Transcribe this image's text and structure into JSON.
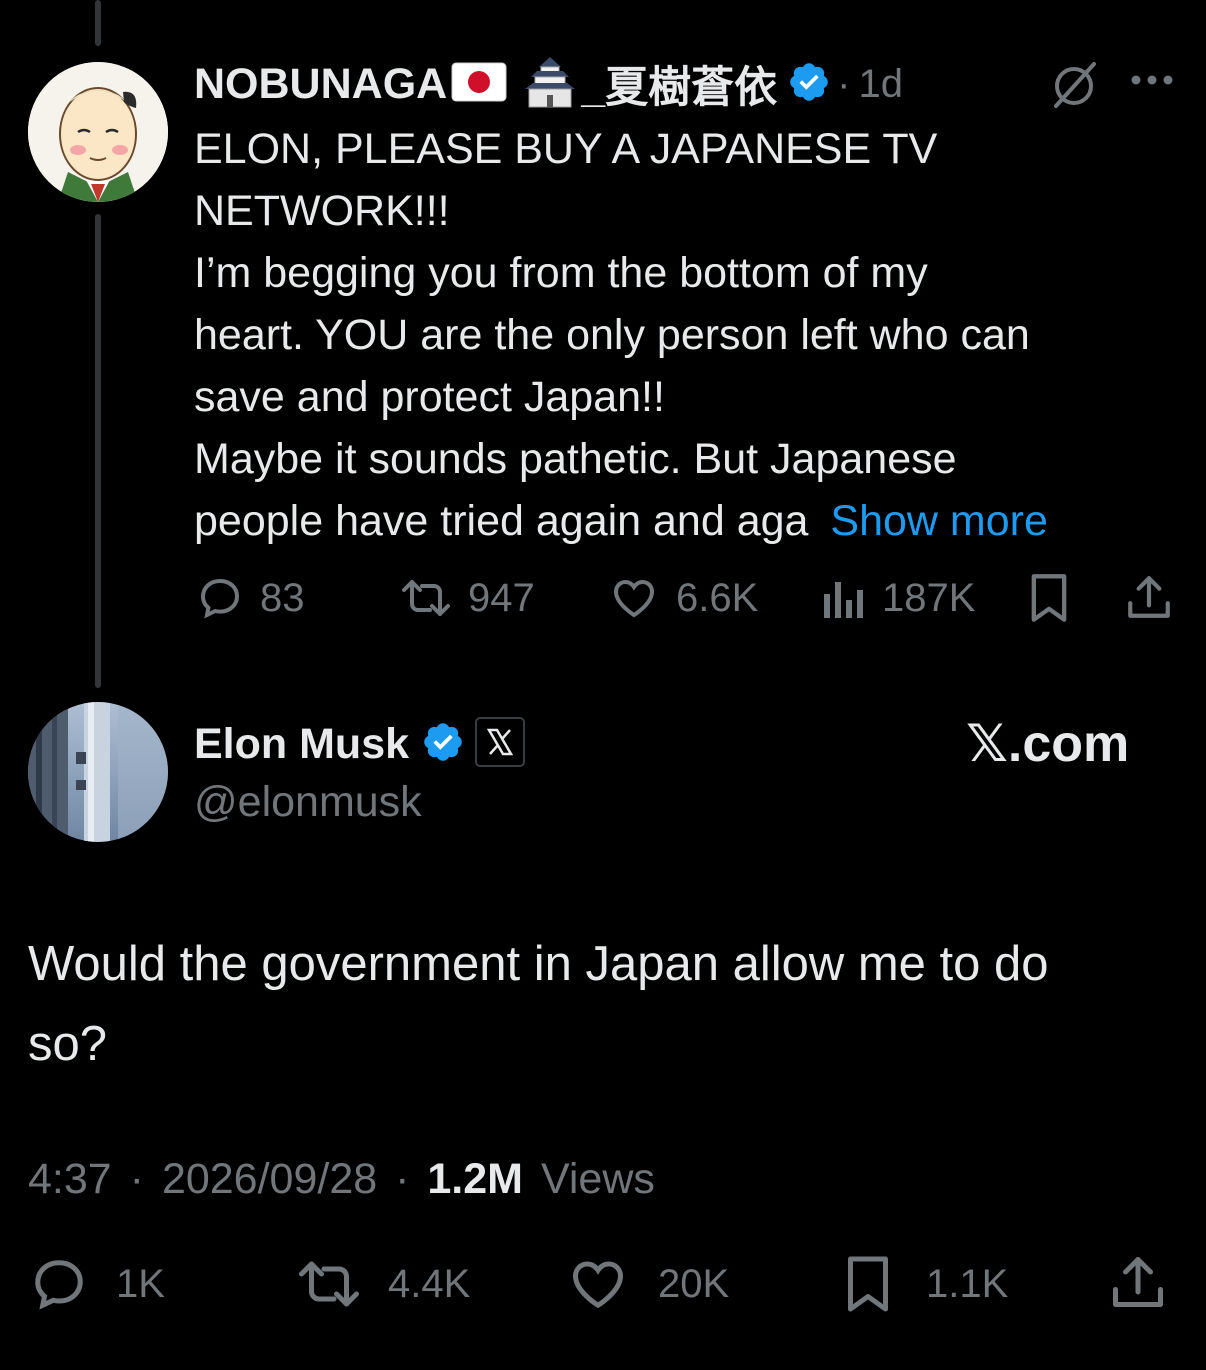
{
  "reply_tweet": {
    "display_name": "NOBUNAGA",
    "name_suffix": "_夏樹蒼依",
    "time_sep": "·",
    "time": "1d",
    "more_glyph": "···",
    "text_lines": [
      "ELON, PLEASE BUY A JAPANESE TV",
      "NETWORK!!!",
      "I’m begging you from the bottom of my",
      "heart. YOU are the only person left who can",
      "save and protect Japan!!",
      "Maybe it sounds pathetic. But Japanese"
    ],
    "last_line": "people have tried again and aga",
    "show_more": "Show more",
    "stats": {
      "replies": "83",
      "reposts": "947",
      "likes": "6.6K",
      "views": "187K"
    }
  },
  "main_tweet": {
    "display_name": "Elon Musk",
    "handle": "@elonmusk",
    "brand": "𝕏.com",
    "text_line1": "Would the government in Japan allow me to do",
    "text_line2": "so?",
    "time": "4:37",
    "sep1": "·",
    "date": "2026/09/28",
    "sep2": "·",
    "views_count": "1.2M",
    "views_label": "Views",
    "stats": {
      "replies": "1K",
      "reposts": "4.4K",
      "likes": "20K",
      "bookmarks": "1.1K"
    }
  },
  "colors": {
    "background": "#000000",
    "text": "#e7e9ea",
    "muted": "#71767b",
    "link": "#1d9bf0",
    "verified": "#1d9bf0"
  },
  "icons": [
    "verified-badge-icon",
    "japan-flag-icon",
    "castle-icon",
    "grok-icon",
    "more-icon",
    "reply-icon",
    "repost-icon",
    "like-icon",
    "views-icon",
    "bookmark-icon",
    "share-icon",
    "x-logo-icon"
  ]
}
